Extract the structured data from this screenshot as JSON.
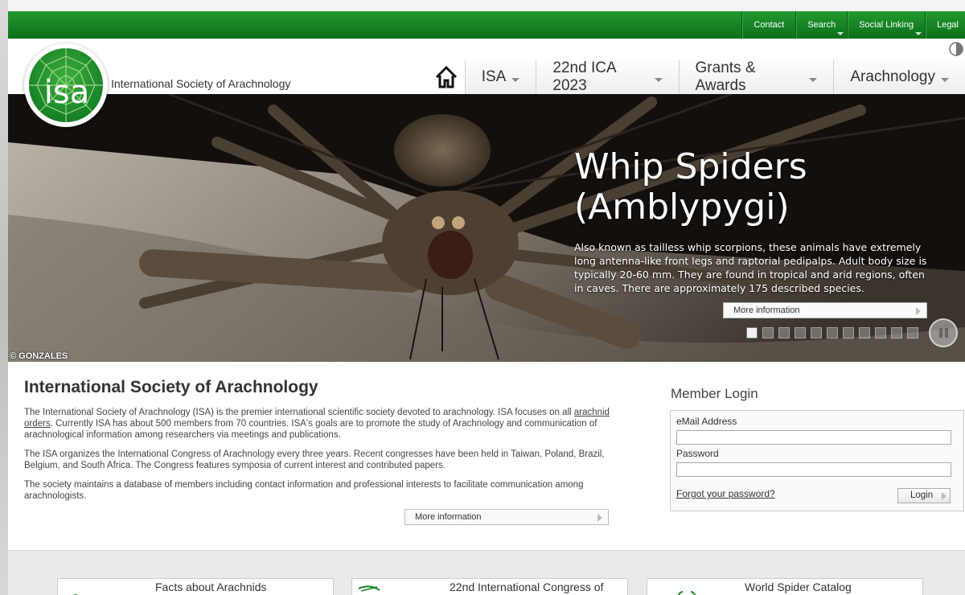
{
  "toplinks": [
    {
      "label": "Contact",
      "has_menu": false
    },
    {
      "label": "Search",
      "has_menu": true
    },
    {
      "label": "Social Linking",
      "has_menu": true
    },
    {
      "label": "Legal",
      "has_menu": false
    }
  ],
  "site": {
    "name": "International Society of Arachnology",
    "logo_text": "isa"
  },
  "nav": [
    {
      "label": "ISA"
    },
    {
      "label": "22nd ICA 2023"
    },
    {
      "label": "Grants & Awards"
    },
    {
      "label": "Arachnology"
    }
  ],
  "hero": {
    "title_line1": "Whip Spiders",
    "title_line2": "(Amblypygi)",
    "text": "Also known as tailless whip scorpions, these animals have extremely long antenna-like front legs and raptorial pedipalps. Adult body size is typically 20-60 mm. They are found in tropical and arid regions, often in caves. There are approximately 175 described species.",
    "more_label": "More information",
    "credit": "© GONZALES",
    "slide_count": 11,
    "active_slide": 1
  },
  "main": {
    "title": "International Society of Arachnology",
    "p1_before": "The International Society of Arachnology (ISA) is the premier international scientific society devoted to arachnology. ISA focuses on all ",
    "p1_link": "arachnid orders",
    "p1_after": ". Currently ISA has about 500 members from 70 countries. ISA's goals are to promote the study of Arachnology and communication of arachnological information among researchers via meetings and publications.",
    "p2": "The ISA organizes the International Congress of Arachnology every three years. Recent congresses have been held in Taiwan, Poland, Brazil, Belgium, and South Africa. The Congress features symposia of current interest and contributed papers.",
    "p3": "The society maintains a database of members including contact information and professional interests to facilitate communication among arachnologists.",
    "more_label": "More information"
  },
  "login": {
    "title": "Member Login",
    "email_label": "eMail Address",
    "email_value": "",
    "password_label": "Password",
    "password_value": "",
    "forgot_label": "Forgot your password?",
    "button_label": "Login"
  },
  "footer_boxes": [
    {
      "label": "Facts about Arachnids"
    },
    {
      "label": "22nd International Congress of"
    },
    {
      "label": "World Spider Catalog"
    }
  ],
  "colors": {
    "brand_green": "#138426",
    "topbar_dark": "#0c6e1b"
  }
}
